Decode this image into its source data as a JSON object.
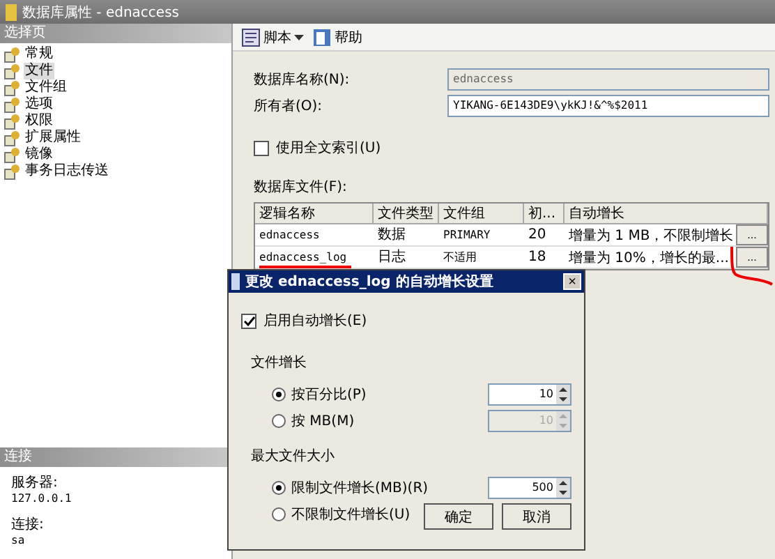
{
  "window": {
    "title": "数据库属性 - ednaccess"
  },
  "sidebar": {
    "header": "选择页",
    "items": [
      {
        "label": "常规",
        "selected": false
      },
      {
        "label": "文件",
        "selected": true
      },
      {
        "label": "文件组",
        "selected": false
      },
      {
        "label": "选项",
        "selected": false
      },
      {
        "label": "权限",
        "selected": false
      },
      {
        "label": "扩展属性",
        "selected": false
      },
      {
        "label": "镜像",
        "selected": false
      },
      {
        "label": "事务日志传送",
        "selected": false
      }
    ]
  },
  "connection": {
    "header": "连接",
    "fields": [
      {
        "label": "服务器:",
        "value": "127.0.0.1"
      },
      {
        "label": "连接:",
        "value": "sa"
      }
    ]
  },
  "toolbar": [
    {
      "label": "脚本",
      "kind": "dropdown"
    },
    {
      "label": "帮助",
      "kind": "help"
    }
  ],
  "form": {
    "name": {
      "label": "数据库名称(N):",
      "value": "ednaccess",
      "disabled": true
    },
    "owner": {
      "label": "所有者(O):",
      "value": "YIKANG-6E143DE9\\ykKJ!&^%$2011",
      "disabled": false
    },
    "fulltext": {
      "label": "使用全文索引(U)",
      "checked": false
    }
  },
  "files": {
    "label": "数据库文件(F):",
    "columns": [
      "逻辑名称",
      "文件类型",
      "文件组",
      "初...",
      "自动增长"
    ],
    "rows": [
      {
        "cells": [
          "ednaccess",
          "数据",
          "PRIMARY",
          "20",
          "增量为 1 MB，不限制增长"
        ],
        "button": "...",
        "marked": false
      },
      {
        "cells": [
          "ednaccess_log",
          "日志",
          "不适用",
          "18",
          "增量为 10%，增长的最..."
        ],
        "button": "...",
        "marked": true
      }
    ]
  },
  "dialog": {
    "title": "更改 ednaccess_log 的自动增长设置",
    "close": "×",
    "enable": {
      "label": "启用自动增长(E)",
      "checked": true
    },
    "groups": [
      {
        "header": "文件增长",
        "options": [
          {
            "label": "按百分比(P)",
            "selected": true,
            "value": "10"
          },
          {
            "label": "按 MB(M)",
            "selected": false,
            "value": "10"
          }
        ]
      },
      {
        "header": "最大文件大小",
        "options": [
          {
            "label": "限制文件增长(MB)(R)",
            "selected": true,
            "value": "500"
          },
          {
            "label": "不限制文件增长(U)",
            "selected": false
          }
        ]
      }
    ],
    "buttons": [
      "确定",
      "取消"
    ]
  }
}
